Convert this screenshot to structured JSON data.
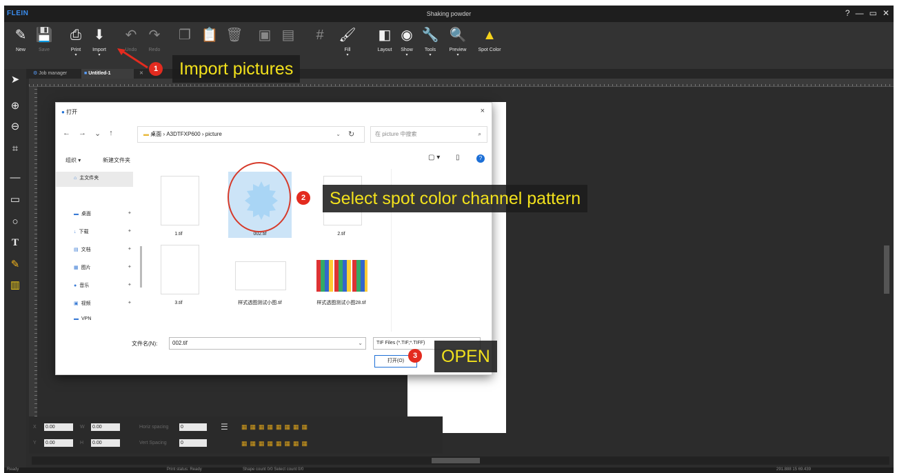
{
  "app": {
    "logo": "FLEIN",
    "window_title": "Shaking powder",
    "window_buttons": [
      "?",
      "—",
      "▭",
      "✕"
    ]
  },
  "toolbar": {
    "buttons": [
      {
        "label": "New",
        "icon": "new-document-icon",
        "glyph": "✎",
        "enabled": true,
        "caret": false
      },
      {
        "label": "Save",
        "icon": "save-icon",
        "glyph": "💾",
        "enabled": false,
        "caret": false
      },
      {
        "label": "Print",
        "icon": "printer-icon",
        "glyph": "⎙",
        "enabled": true,
        "caret": true
      },
      {
        "label": "Import",
        "icon": "import-icon",
        "glyph": "⬇",
        "enabled": true,
        "caret": true
      },
      {
        "label": "Undo",
        "icon": "undo-icon",
        "glyph": "↶",
        "enabled": false,
        "caret": false
      },
      {
        "label": "Redo",
        "icon": "redo-icon",
        "glyph": "↷",
        "enabled": false,
        "caret": false
      },
      {
        "label": "",
        "icon": "copy-icon",
        "glyph": "❐",
        "enabled": false,
        "caret": false
      },
      {
        "label": "",
        "icon": "paste-icon",
        "glyph": "📋",
        "enabled": false,
        "caret": false
      },
      {
        "label": "",
        "icon": "delete-icon",
        "glyph": "🗑",
        "enabled": false,
        "caret": false
      },
      {
        "label": "",
        "icon": "group-icon",
        "glyph": "▣",
        "enabled": false,
        "caret": false
      },
      {
        "label": "",
        "icon": "ungroup-icon",
        "glyph": "▤",
        "enabled": false,
        "caret": false
      },
      {
        "label": "",
        "icon": "grid-icon",
        "glyph": "#",
        "enabled": false,
        "caret": false
      },
      {
        "label": "Fill",
        "icon": "fill-icon",
        "glyph": "🖌",
        "enabled": true,
        "caret": true
      },
      {
        "label": "Layout",
        "icon": "layout-icon",
        "glyph": "◧",
        "enabled": true,
        "caret": false
      },
      {
        "label": "Show",
        "icon": "eye-icon",
        "glyph": "◉",
        "enabled": true,
        "caret": true
      },
      {
        "label": "Tools",
        "icon": "wrench-icon",
        "glyph": "🔧",
        "enabled": true,
        "caret": true
      },
      {
        "label": "Preview",
        "icon": "preview-icon",
        "glyph": "🔍",
        "enabled": true,
        "caret": true
      },
      {
        "label": "Spot Color",
        "icon": "spot-color-icon",
        "glyph": "▲",
        "enabled": true,
        "caret": false
      }
    ]
  },
  "tabs": [
    {
      "label": "Job manager",
      "active": false
    },
    {
      "label": "Untitled-1",
      "active": true
    }
  ],
  "dialog": {
    "title": "打开",
    "close": "×",
    "nav": [
      "←",
      "→",
      "⌄",
      "↑"
    ],
    "path": "桌面 › A3DTFXP600 › picture",
    "search_placeholder": "在 picture 中搜索",
    "organize": "组织 ▾",
    "new_folder": "新建文件夹",
    "help": "?",
    "nav_items": [
      {
        "label": "主文件夹",
        "icon": "home-icon",
        "glyph": "⌂",
        "pinned": false
      },
      {
        "label": "桌面",
        "icon": "desktop-icon",
        "glyph": "▬",
        "pinned": true
      },
      {
        "label": "下载",
        "icon": "download-icon",
        "glyph": "↓",
        "pinned": true
      },
      {
        "label": "文档",
        "icon": "document-icon",
        "glyph": "▤",
        "pinned": true
      },
      {
        "label": "图片",
        "icon": "picture-icon",
        "glyph": "▦",
        "pinned": true
      },
      {
        "label": "音乐",
        "icon": "music-icon",
        "glyph": "●",
        "pinned": true
      },
      {
        "label": "视频",
        "icon": "video-icon",
        "glyph": "▣",
        "pinned": true
      },
      {
        "label": "VPN",
        "icon": "folder-icon",
        "glyph": "▬",
        "pinned": false
      }
    ],
    "files": [
      {
        "name": "1.tif",
        "selected": false
      },
      {
        "name": "002.tif",
        "selected": true
      },
      {
        "name": "2.tif",
        "selected": false
      },
      {
        "name": "3.tif",
        "selected": false
      },
      {
        "name": "样式透图测试小图.tif",
        "selected": false
      },
      {
        "name": "样式透图测试小图28.tif",
        "selected": false
      }
    ],
    "filename_label": "文件名(N):",
    "filename_value": "002.tif",
    "filter": "TIF Files (*.TIF;*.TIFF)",
    "open_button": "打开(O)"
  },
  "bottom_panel": {
    "x": "0.00",
    "y": "0.00",
    "w": "0.00",
    "h": "0.00",
    "h_spacing_label": "Horiz spacing",
    "h_spacing": "0",
    "v_spacing_label": "Vert Spacing",
    "v_spacing": "0"
  },
  "status": {
    "left": "Ready",
    "print_status": "Print status: Ready",
    "selection": "Shape count 0/0  Select count 0/0",
    "coords": "291.888  15   69.439"
  },
  "annotations": [
    {
      "step": "1",
      "text": "Import pictures"
    },
    {
      "step": "2",
      "text": "Select spot color channel pattern"
    },
    {
      "step": "3",
      "text": "OPEN"
    }
  ],
  "colors": {
    "callout_text": "#f2e11c",
    "badge": "#e32b1f",
    "accent": "#1c6fd6",
    "selected_file": "#cce4f7",
    "spot_color_icon": "#f5d21b"
  }
}
